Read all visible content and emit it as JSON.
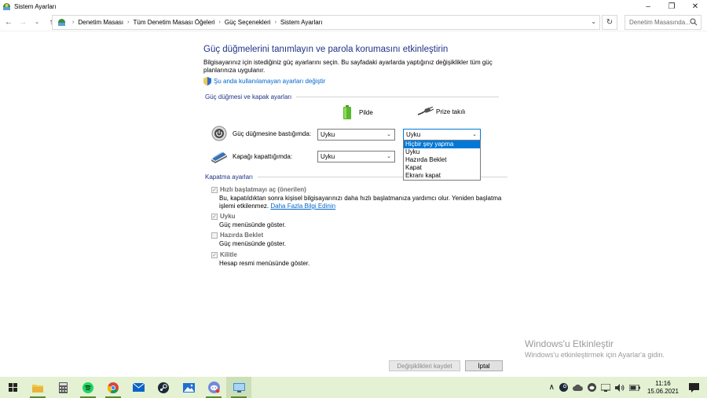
{
  "window": {
    "title": "Sistem Ayarları",
    "minimize_glyph": "–",
    "maximize_glyph": "❐",
    "close_glyph": "✕"
  },
  "address": {
    "crumbs": [
      "Denetim Masası",
      "Tüm Denetim Masası Öğeleri",
      "Güç Seçenekleri",
      "Sistem Ayarları"
    ],
    "search_placeholder": "Denetim Masasında..."
  },
  "main": {
    "title": "Güç düğmelerini tanımlayın ve parola korumasını etkinleştirin",
    "description": "Bilgisayarınız için istediğiniz güç ayarlarını seçin. Bu sayfadaki ayarlarda yaptığınız değişiklikler tüm güç planlarınıza uygulanır.",
    "change_link": "Şu anda kullanılamayan ayarları değiştir",
    "power_section_title": "Güç düğmesi ve kapak ayarları",
    "col_battery": "Pilde",
    "col_plugged": "Prize takılı",
    "rows": [
      {
        "label": "Güç düğmesine bastığımda:",
        "battery": "Uyku",
        "plugged": "Uyku"
      },
      {
        "label": "Kapağı kapattığımda:",
        "battery": "Uyku"
      }
    ],
    "dropdown_options": [
      "Hiçbir şey yapma",
      "Uyku",
      "Hazırda Beklet",
      "Kapat",
      "Ekranı kapat"
    ],
    "dropdown_selected": "Hiçbir şey yapma",
    "shutdown_section_title": "Kapatma ayarları",
    "checkboxes": [
      {
        "label": "Hızlı başlatmayı aç (önerilen)",
        "checked": true,
        "desc": "Bu, kapatıldıktan sonra kişisel bilgisayarınızı daha hızlı başlatmanıza yardımcı olur. Yeniden başlatma işlemi etkilenmez.",
        "link": "Daha Fazla Bilgi Edinin"
      },
      {
        "label": "Uyku",
        "checked": true,
        "desc": "Güç menüsünde göster."
      },
      {
        "label": "Hazırda Beklet",
        "checked": false,
        "desc": "Güç menüsünde göster."
      },
      {
        "label": "Kilitle",
        "checked": true,
        "desc": "Hesap resmi menüsünde göster."
      }
    ],
    "save_button": "Değişiklikleri kaydet",
    "cancel_button": "İptal"
  },
  "watermark": {
    "line1": "Windows'u Etkinleştir",
    "line2": "Windows'u etkinleştirmek için Ayarlar'a gidin."
  },
  "taskbar": {
    "apps": [
      "start-icon",
      "file-explorer-icon",
      "calculator-icon",
      "spotify-icon",
      "chrome-icon",
      "mail-icon",
      "steam-icon",
      "photos-icon",
      "discord-icon",
      "control-panel-icon"
    ],
    "time": "11:16",
    "date": "15.06.2021",
    "colors": {
      "taskbar_bg": "#e4f1d3",
      "accent": "#0078d7"
    }
  }
}
